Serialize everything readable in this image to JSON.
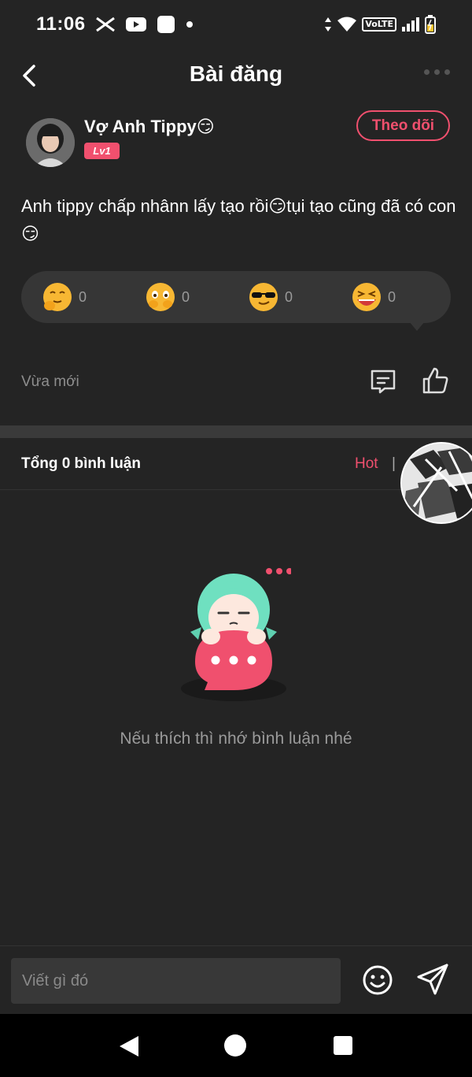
{
  "status_bar": {
    "time": "11:06",
    "network_label": "VoLTE"
  },
  "header": {
    "title": "Bài đăng"
  },
  "author": {
    "name": "Vợ Anh Tippy😏",
    "level": "Lv1",
    "follow_label": "Theo dõi"
  },
  "post": {
    "text": "Anh tippy chấp nhânn lấy tạo rồi😏tụi tạo cũng đã có con😏",
    "time": "Vừa mới"
  },
  "reactions": [
    {
      "icon": "shushing-face-icon",
      "count": "0"
    },
    {
      "icon": "crying-face-icon",
      "count": "0"
    },
    {
      "icon": "sunglasses-face-icon",
      "count": "0"
    },
    {
      "icon": "laughing-face-icon",
      "count": "0"
    }
  ],
  "comments": {
    "total_label": "Tổng 0 bình luận",
    "sort_hot": "Hot",
    "sort_divider": "|",
    "empty_message": "Nếu thích thì nhớ bình luận nhé"
  },
  "composer": {
    "placeholder": "Viết gì đó"
  },
  "colors": {
    "background": "#242424",
    "accent": "#f0506e",
    "reaction_bar": "#363636",
    "muted_text": "#8e8e8e"
  }
}
